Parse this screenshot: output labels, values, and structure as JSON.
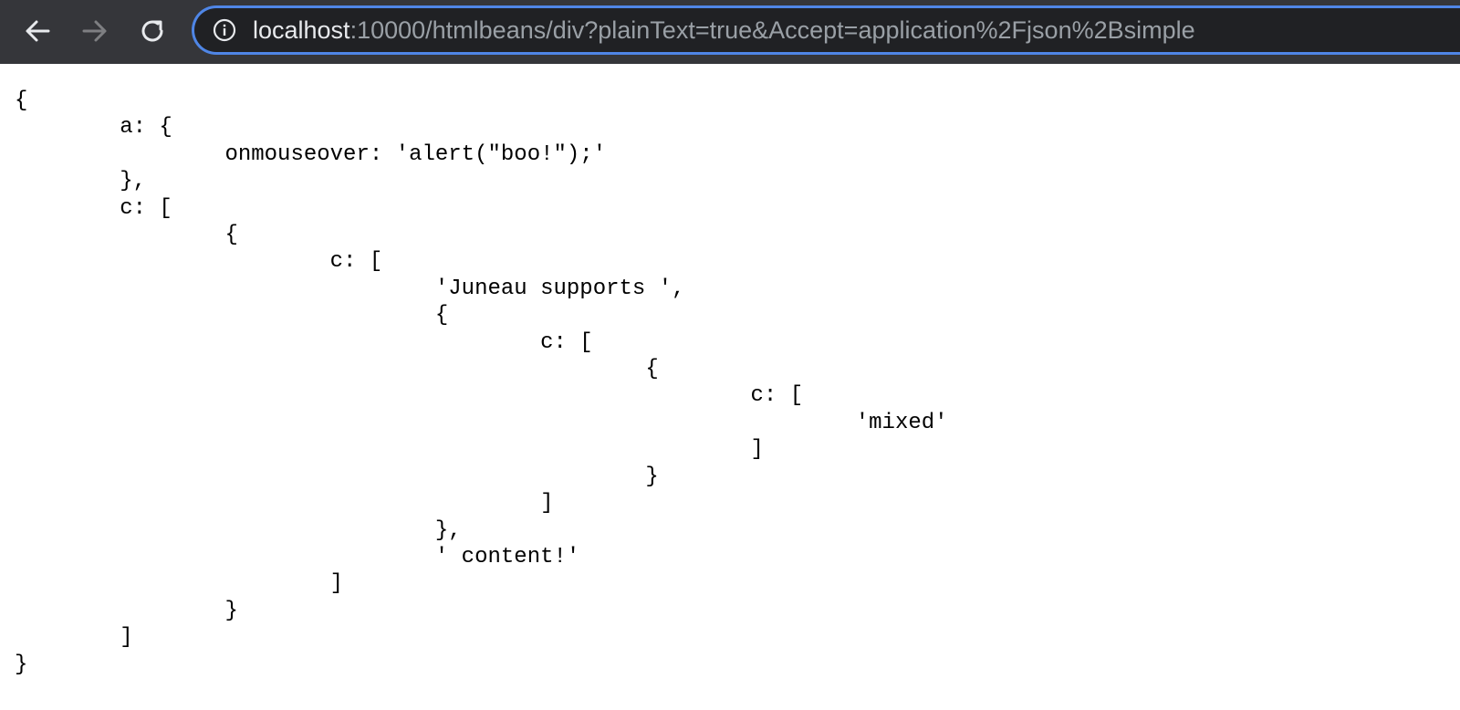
{
  "browser": {
    "back_icon": "arrow-left-icon",
    "forward_icon": "arrow-right-icon",
    "reload_icon": "reload-icon",
    "info_icon": "info-icon",
    "url_host": "localhost",
    "url_rest": ":10000/htmlbeans/div?plainText=true&Accept=application%2Fjson%2Bsimple"
  },
  "page": {
    "lines": [
      "{",
      "\ta: {",
      "\t\tonmouseover: 'alert(\"boo!\");'",
      "\t},",
      "\tc: [",
      "\t\t{",
      "\t\t\tc: [",
      "\t\t\t\t'Juneau supports ',",
      "\t\t\t\t{",
      "\t\t\t\t\tc: [",
      "\t\t\t\t\t\t{",
      "\t\t\t\t\t\t\tc: [",
      "\t\t\t\t\t\t\t\t'mixed'",
      "\t\t\t\t\t\t\t]",
      "\t\t\t\t\t\t}",
      "\t\t\t\t\t]",
      "\t\t\t\t},",
      "\t\t\t\t' content!'",
      "\t\t\t]",
      "\t\t}",
      "\t]",
      "}"
    ]
  },
  "colors": {
    "toolbar_bg": "#35363a",
    "omnibox_bg": "#202124",
    "omnibox_focus_border": "#4f86e6",
    "url_host_color": "#e8eaed",
    "url_rest_color": "#9aa0a6"
  }
}
